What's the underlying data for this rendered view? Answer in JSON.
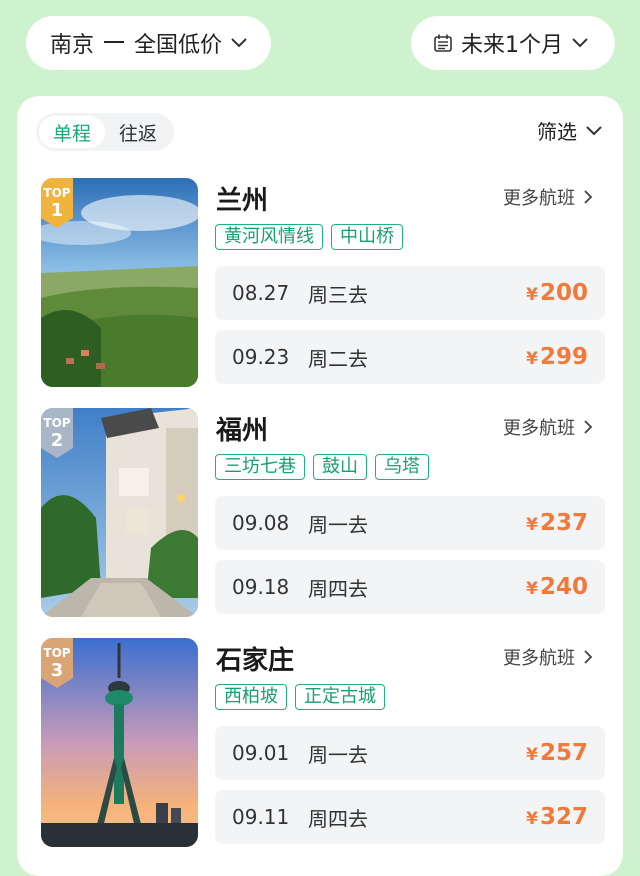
{
  "header": {
    "route_from": "南京",
    "route_to": "全国低价",
    "date_range": "未来1个月"
  },
  "tabs": [
    {
      "label": "单程",
      "active": true
    },
    {
      "label": "往返",
      "active": false
    }
  ],
  "filter_label": "筛选",
  "more_flights_label": "更多航班",
  "currency": "¥",
  "badge_label": "TOP",
  "destinations": [
    {
      "rank": "1",
      "city": "兰州",
      "tags": [
        "黄河风情线",
        "中山桥"
      ],
      "flights": [
        {
          "date": "08.27",
          "day": "周三去",
          "price": "200"
        },
        {
          "date": "09.23",
          "day": "周二去",
          "price": "299"
        }
      ]
    },
    {
      "rank": "2",
      "city": "福州",
      "tags": [
        "三坊七巷",
        "鼓山",
        "乌塔"
      ],
      "flights": [
        {
          "date": "09.08",
          "day": "周一去",
          "price": "237"
        },
        {
          "date": "09.18",
          "day": "周四去",
          "price": "240"
        }
      ]
    },
    {
      "rank": "3",
      "city": "石家庄",
      "tags": [
        "西柏坡",
        "正定古城"
      ],
      "flights": [
        {
          "date": "09.01",
          "day": "周一去",
          "price": "257"
        },
        {
          "date": "09.11",
          "day": "周四去",
          "price": "327"
        }
      ]
    }
  ],
  "colors": {
    "background": "#cdf2cd",
    "accent_green": "#19a974",
    "price_orange": "#f07a3c",
    "badge_gold": "#f0b43c",
    "badge_silver": "#a9b6c8",
    "badge_bronze": "#d9a574"
  }
}
